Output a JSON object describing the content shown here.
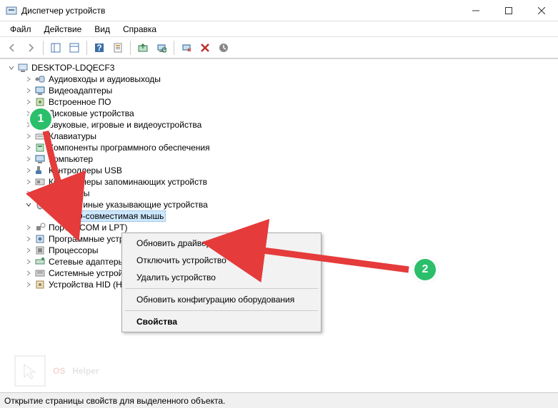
{
  "window": {
    "title": "Диспетчер устройств"
  },
  "menubar": {
    "file": "Файл",
    "action": "Действие",
    "view": "Вид",
    "help": "Справка"
  },
  "tree": {
    "root": "DESKTOP-LDQECF3",
    "nodes": [
      "Аудиовходы и аудиовыходы",
      "Видеоадаптеры",
      "Встроенное ПО",
      "Дисковые устройства",
      "Звуковые, игровые и видеоустройства",
      "Клавиатуры",
      "Компоненты программного обеспечения",
      "Компьютер",
      "Контроллеры USB",
      "Контроллеры запоминающих устройств",
      "Мониторы",
      "Мыши и иные указывающие устройства",
      "Порты (COM и LPT)",
      "Программные устройства",
      "Процессоры",
      "Сетевые адаптеры",
      "Системные устройства",
      "Устройства HID (Human Interface Devices)"
    ],
    "selected_child": "HID-совместимая мышь"
  },
  "context_menu": {
    "update_driver": "Обновить драйвер",
    "disable_device": "Отключить устройство",
    "uninstall_device": "Удалить устройство",
    "scan_hardware": "Обновить конфигурацию оборудования",
    "properties": "Свойства"
  },
  "statusbar": {
    "text": "Открытие страницы свойств для выделенного объекта."
  },
  "badges": {
    "one": "1",
    "two": "2"
  },
  "watermark": {
    "os": "OS",
    "helper": "Helper"
  }
}
